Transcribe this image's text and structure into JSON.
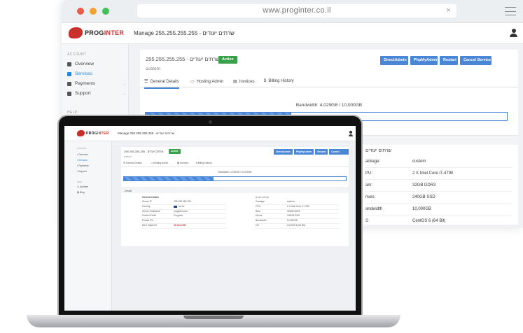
{
  "browser": {
    "url": "www.proginter.co.il",
    "close_glyph": "×",
    "dot_colors": [
      "#ec5a4a",
      "#f2a42f",
      "#42c05a"
    ]
  },
  "brand": {
    "name_prefix": "PROG",
    "name_suffix": "INTER",
    "accent": "#c9302c",
    "primary": "#4a86d8",
    "success": "#3aa14b"
  },
  "header": {
    "title": "Manage 255.255.255.255 - שרתים יעודים"
  },
  "sidebar": {
    "account_heading": "ACCOUNT",
    "items": [
      {
        "label": "Overview",
        "icon": "grid-icon"
      },
      {
        "label": "Services",
        "icon": "services-icon"
      },
      {
        "label": "Payments",
        "icon": "wallet-icon"
      },
      {
        "label": "Support",
        "icon": "mail-icon"
      }
    ],
    "help_heading": "HELP",
    "help_items": [
      {
        "label": "Updates",
        "icon": "clock-icon"
      },
      {
        "label": "Blog",
        "icon": "blog-icon"
      }
    ]
  },
  "service": {
    "title": "שרתים יעודים - 255.255.255.255",
    "status": "Active",
    "subtitle": "custom",
    "actions": [
      "DirectAdmin",
      "PhpMyAdmin",
      "Restart",
      "Cancel Service"
    ]
  },
  "tabs": [
    {
      "label": "General Details",
      "icon": "list-icon"
    },
    {
      "label": "Hosting Admin",
      "icon": "monitor-icon"
    },
    {
      "label": "Invoices",
      "icon": "invoice-icon"
    },
    {
      "label": "Billing History",
      "icon": "dollar-icon"
    }
  ],
  "bandwidth": {
    "label": "Bandwidth: 4,029GB / 10,000GB",
    "used_fraction": 0.4029
  },
  "details_heading": "Details",
  "general": {
    "heading": "General Details",
    "rows": [
      {
        "key": "Server IP",
        "value": "255.255.255.255"
      },
      {
        "key": "Country",
        "value": "ישראל"
      },
      {
        "key": "Server Hostname",
        "value": "proginter.com"
      },
      {
        "key": "Control Panel",
        "value": "Proginter"
      },
      {
        "key": "Private IPs",
        "value": "-"
      },
      {
        "key": "Next Payment",
        "value": "30 Oct 2017"
      }
    ]
  },
  "specs": {
    "heading": "שרתים יעודים",
    "rows": [
      {
        "key": "Package",
        "value": "custom"
      },
      {
        "key": "CPU",
        "value": "2 X Intel Core i7-4790"
      },
      {
        "key": "Ram",
        "value": "32GB DDR3"
      },
      {
        "key": "Drives",
        "value": "240GB SSD"
      },
      {
        "key": "Bandwidth",
        "value": "10,000GB"
      },
      {
        "key": "OS",
        "value": "CentOS 6 (64 Bit)"
      }
    ],
    "visible_key_fragments": [
      "ackage:",
      "PU:",
      "am:",
      "rives:",
      "andwidth",
      "S"
    ]
  }
}
